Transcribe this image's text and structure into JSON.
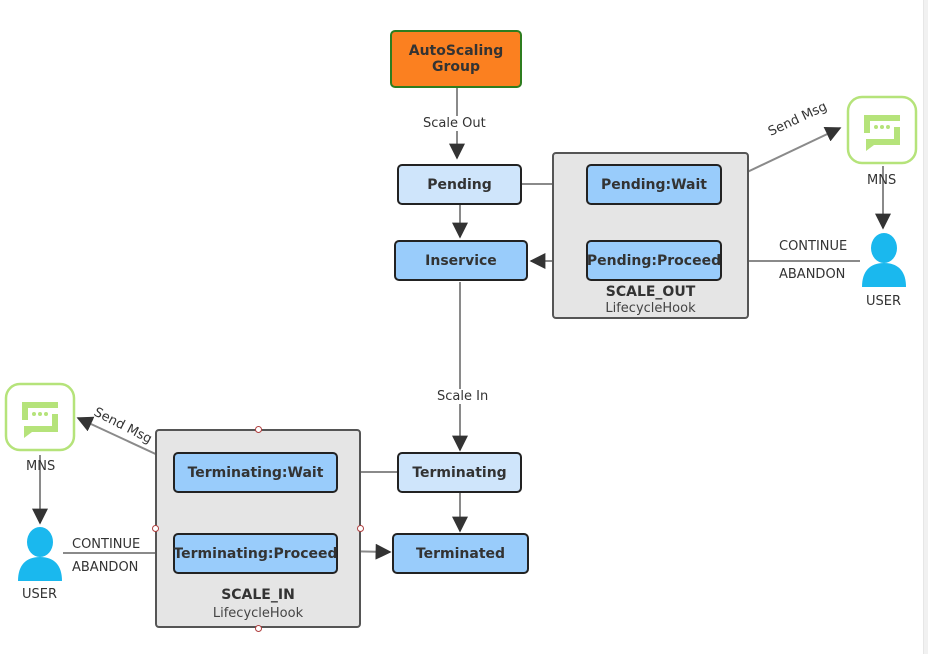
{
  "nodes": {
    "autoscaling_group": "AutoScaling\nGroup",
    "autoscaling_line1": "AutoScaling",
    "autoscaling_line2": "Group",
    "pending": "Pending",
    "inservice": "Inservice",
    "pending_wait": "Pending:Wait",
    "pending_proceed": "Pending:Proceed",
    "terminating": "Terminating",
    "terminated": "Terminated",
    "terminating_wait": "Terminating:Wait",
    "terminating_proceed": "Terminating:Proceed"
  },
  "hooks": {
    "scale_out": {
      "title": "SCALE_OUT",
      "subtitle": "LifecycleHook"
    },
    "scale_in": {
      "title": "SCALE_IN",
      "subtitle": "LifecycleHook"
    }
  },
  "edge_labels": {
    "scale_out": "Scale Out",
    "scale_in": "Scale In",
    "send_msg": "Send Msg",
    "continue": "CONTINUE",
    "abandon": "ABANDON"
  },
  "actors": {
    "mns": "MNS",
    "user": "USER"
  },
  "colors": {
    "autoscaling_fill": "#fb8020",
    "autoscaling_border": "#2e7d1f",
    "state_light": "#cfe5fb",
    "state_dark": "#99ccfb",
    "hook_fill": "#e5e5e5",
    "mns_icon": "#b5e37a",
    "user_icon": "#1ab8ee"
  }
}
